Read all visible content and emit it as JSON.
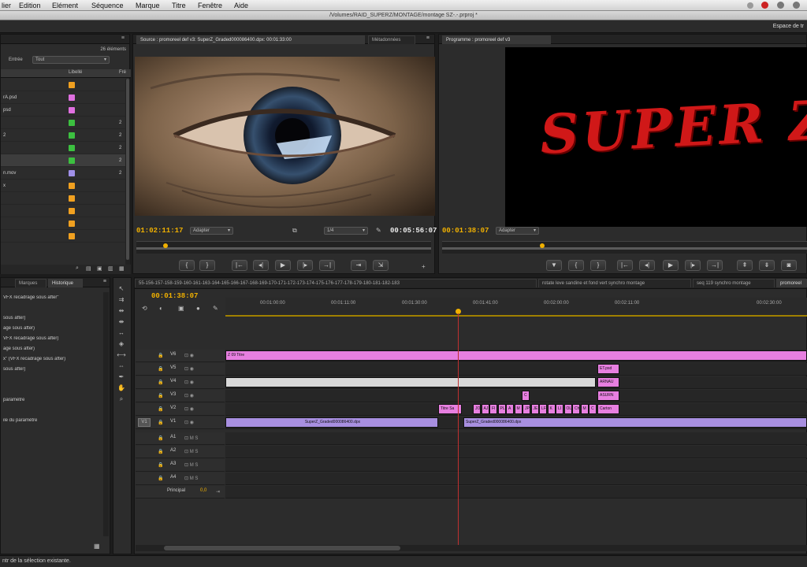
{
  "menu": {
    "items": [
      "lier",
      "Edition",
      "Elément",
      "Séquence",
      "Marque",
      "Titre",
      "Fenêtre",
      "Aide"
    ]
  },
  "title_path": "/Volumes/RAID_SUPERZ/MONTAGE/montage SZ-.-.prproj *",
  "workspace_label": "Espace de tr",
  "project": {
    "count": "26 éléments",
    "filter_label": "Entrée",
    "filter_value": "Tout",
    "col_usage": "Libellé",
    "col_fr": "Fré",
    "rows": [
      {
        "name": "",
        "color": "#f0a020",
        "val": ""
      },
      {
        "name": "rA.psd",
        "color": "#e070e0",
        "val": ""
      },
      {
        "name": "psd",
        "color": "#e070e0",
        "val": ""
      },
      {
        "name": "",
        "color": "#3cc040",
        "val": "2"
      },
      {
        "name": "2",
        "color": "#3cc040",
        "val": "2"
      },
      {
        "name": "",
        "color": "#3cc040",
        "val": "2"
      },
      {
        "name": "",
        "color": "#3cc040",
        "val": "2"
      },
      {
        "name": "n.mov",
        "color": "#a090e8",
        "val": "2"
      },
      {
        "name": "x",
        "color": "#f0a020",
        "val": ""
      },
      {
        "name": "",
        "color": "#f0a020",
        "val": ""
      },
      {
        "name": "",
        "color": "#f0a020",
        "val": ""
      },
      {
        "name": "",
        "color": "#f0a020",
        "val": ""
      },
      {
        "name": "",
        "color": "#f0a020",
        "val": ""
      }
    ]
  },
  "source": {
    "tab_label": "Source : promoreel def v3: SuperZ_Graded000086400.dpx: 00:01:33:00",
    "tab2_label": "Métadonnées",
    "tc_in": "01:02:11:17",
    "fit": "Adapter",
    "res": "1/4",
    "tc_dur": "00:05:56:07"
  },
  "program": {
    "tab_label": "Programme : promoreel def v3",
    "title_text": "SUPER Z",
    "tc_in": "00:01:38:07",
    "fit": "Adapter"
  },
  "left_bottom": {
    "tab1": "Marques",
    "tab2": "Historique",
    "history": [
      "VFX recadrage sous after\"",
      "",
      "sous after)",
      "age sous after)",
      "VFX recadrage sous after)",
      "age sous after)",
      "x\" (VFX recadrage sous after)",
      "sous after)",
      "",
      "",
      "paramètre",
      "",
      "ile du paramètre"
    ]
  },
  "timeline": {
    "tabs": [
      "55-156-157-158-159-160-161-163-164-165-166-167-168-169-170-171-172-173-174-175-176-177-178-179-180-181-182-183",
      "rotate leve sandine et fond vert synchro montage",
      "seq 119 synchro montage",
      "promoreel"
    ],
    "tc": "00:01:38:07",
    "ruler": [
      "00:01:00:00",
      "00:01:11:00",
      "00:01:30:00",
      "00:01:41:00",
      "00:02:00:00",
      "00:02:11:00",
      "00:02:30:00"
    ],
    "video_tracks": [
      "V6",
      "V5",
      "V4",
      "V3",
      "V2",
      "V1"
    ],
    "audio_tracks": [
      "A1",
      "A2",
      "A3",
      "A4"
    ],
    "principal": "Principal",
    "principal_val": "0,0",
    "src_patch": "V1",
    "clips": {
      "v6": "Z 09 Titre",
      "v5": "ET.psd",
      "v4": "ARNAU",
      "v3": "ASURN",
      "v3b": "C",
      "v2a": "Titre Sa",
      "v2b": [
        "JO",
        "AJ",
        "FI",
        "PL",
        "A",
        "M",
        "JP",
        "JE",
        "LF",
        "K",
        "LI",
        "OL",
        "Ch",
        "M",
        "C"
      ],
      "v2c": "Carton",
      "v1a": "SuperZ_Graded000086400.dpx",
      "v1b": "SuperZ_Graded000086400.dpx"
    }
  },
  "status": "ntr de la sélection existante."
}
